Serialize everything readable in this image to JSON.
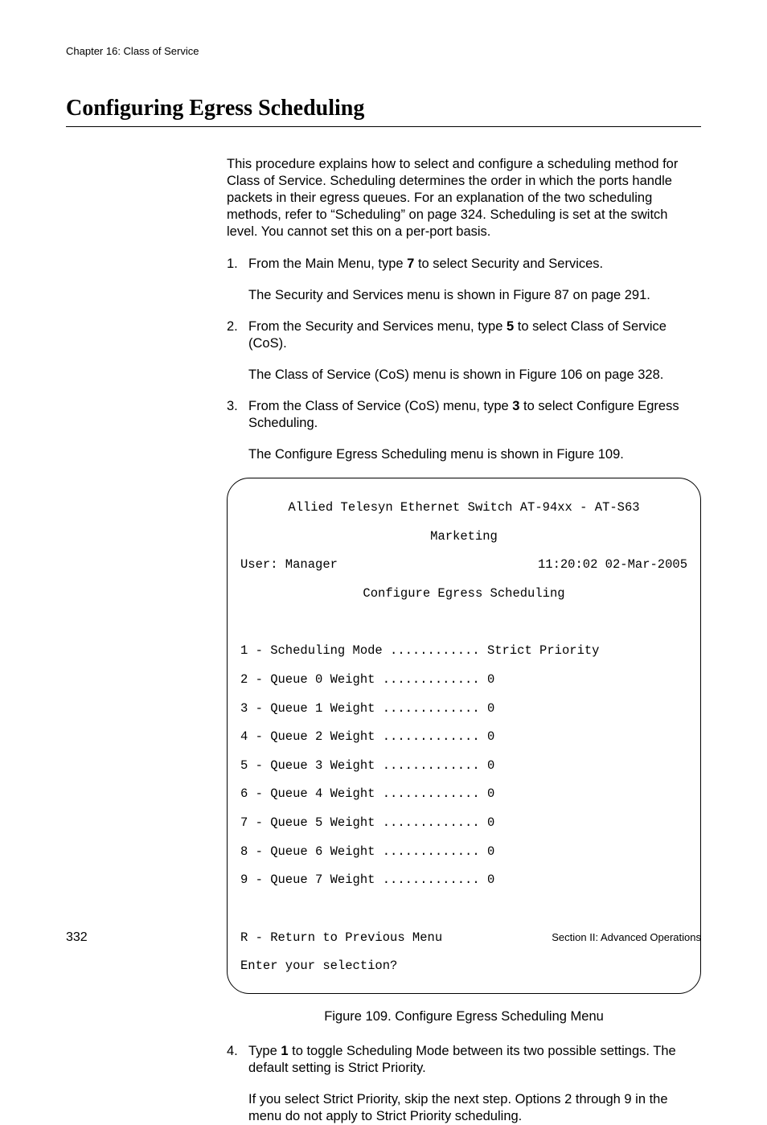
{
  "header": {
    "chapter": "Chapter 16: Class of Service"
  },
  "heading": "Configuring Egress Scheduling",
  "intro": "This procedure explains how to select and configure a scheduling method for Class of Service. Scheduling determines the order in which the ports handle packets in their egress queues. For an explanation of the two scheduling methods, refer to “Scheduling” on page 324. Scheduling is set at the switch level. You cannot set this on a per-port basis.",
  "steps": {
    "s1_num": "1.",
    "s1_pre": "From the Main Menu, type ",
    "s1_bold": "7",
    "s1_post": " to select Security and Services.",
    "s1_sub": "The Security and Services menu is shown in Figure 87 on page 291.",
    "s2_num": "2.",
    "s2_pre": "From the Security and Services menu, type ",
    "s2_bold": "5",
    "s2_post": " to select Class of Service (CoS).",
    "s2_sub": "The Class of Service (CoS) menu is shown in Figure 106 on page 328.",
    "s3_num": "3.",
    "s3_pre": "From the Class of Service (CoS) menu, type ",
    "s3_bold": "3",
    "s3_post": " to select Configure Egress Scheduling.",
    "s3_sub": "The Configure Egress Scheduling menu is shown in Figure 109.",
    "s4_num": "4.",
    "s4_pre": "Type ",
    "s4_bold": "1",
    "s4_post": " to toggle Scheduling Mode between its two possible settings. The default setting is Strict Priority.",
    "s4_sub": "If you select Strict Priority, skip the next step. Options 2 through 9 in the menu do not apply to Strict Priority scheduling."
  },
  "terminal": {
    "title": "Allied Telesyn Ethernet Switch AT-94xx - AT-S63",
    "subtitle": "Marketing",
    "user": "User: Manager",
    "timestamp": "11:20:02 02-Mar-2005",
    "menu_title": "Configure Egress Scheduling",
    "l1": "1 - Scheduling Mode ............ Strict Priority",
    "l2": "2 - Queue 0 Weight ............. 0",
    "l3": "3 - Queue 1 Weight ............. 0",
    "l4": "4 - Queue 2 Weight ............. 0",
    "l5": "5 - Queue 3 Weight ............. 0",
    "l6": "6 - Queue 4 Weight ............. 0",
    "l7": "7 - Queue 5 Weight ............. 0",
    "l8": "8 - Queue 6 Weight ............. 0",
    "l9": "9 - Queue 7 Weight ............. 0",
    "ret": "R - Return to Previous Menu",
    "prompt": "Enter your selection?"
  },
  "figure_caption": "Figure 109. Configure Egress Scheduling Menu",
  "footer": {
    "page": "332",
    "section": "Section II: Advanced Operations"
  }
}
